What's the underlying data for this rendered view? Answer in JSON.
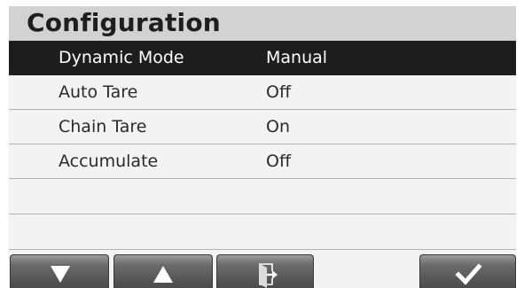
{
  "screen": {
    "title": "Configuration"
  },
  "settings": [
    {
      "label": "Dynamic Mode",
      "value": "Manual",
      "selected": true
    },
    {
      "label": "Auto Tare",
      "value": "Off",
      "selected": false
    },
    {
      "label": "Chain Tare",
      "value": "On",
      "selected": false
    },
    {
      "label": "Accumulate",
      "value": "Off",
      "selected": false
    },
    {
      "label": "",
      "value": "",
      "selected": false
    },
    {
      "label": "",
      "value": "",
      "selected": false
    }
  ],
  "toolbar": {
    "buttons": [
      {
        "icon": "arrow-down-icon"
      },
      {
        "icon": "arrow-up-icon"
      },
      {
        "icon": "exit-icon"
      },
      {
        "icon": "checkmark-icon"
      }
    ]
  },
  "colors": {
    "title_bar": "#d2d2d2",
    "selected_row": "#1d1d1d",
    "row_background": "#f3f3f3",
    "button_gradient_top": "#9a9a9a",
    "button_gradient_bottom": "#4a4a4a"
  }
}
